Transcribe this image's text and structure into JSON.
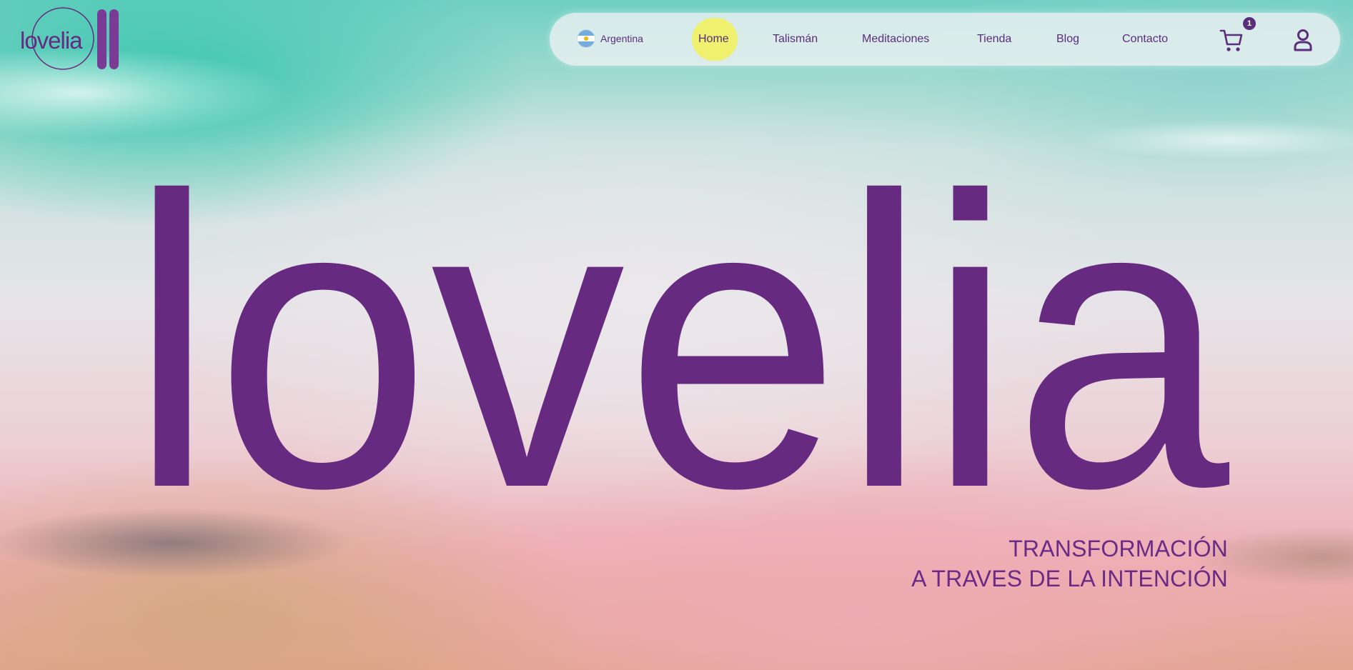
{
  "brand": {
    "logo_text": "lovelia",
    "hero_word": "lovelia",
    "color": "#662a80"
  },
  "nav": {
    "country": {
      "label": "Argentina",
      "flag_icon": "argentina-flag-icon"
    },
    "items": [
      {
        "label": "Home",
        "active": true
      },
      {
        "label": "Talismán",
        "active": false
      },
      {
        "label": "Meditaciones",
        "active": false
      },
      {
        "label": "Tienda",
        "active": false
      },
      {
        "label": "Blog",
        "active": false
      },
      {
        "label": "Contacto",
        "active": false
      }
    ],
    "cart": {
      "icon": "cart-icon",
      "count": "1"
    },
    "account": {
      "icon": "user-icon"
    },
    "active_highlight_color": "#eef06e"
  },
  "hero": {
    "tagline_line1": "TRANSFORMACIÓN",
    "tagline_line2": "A TRAVES DE LA INTENCIÓN"
  }
}
